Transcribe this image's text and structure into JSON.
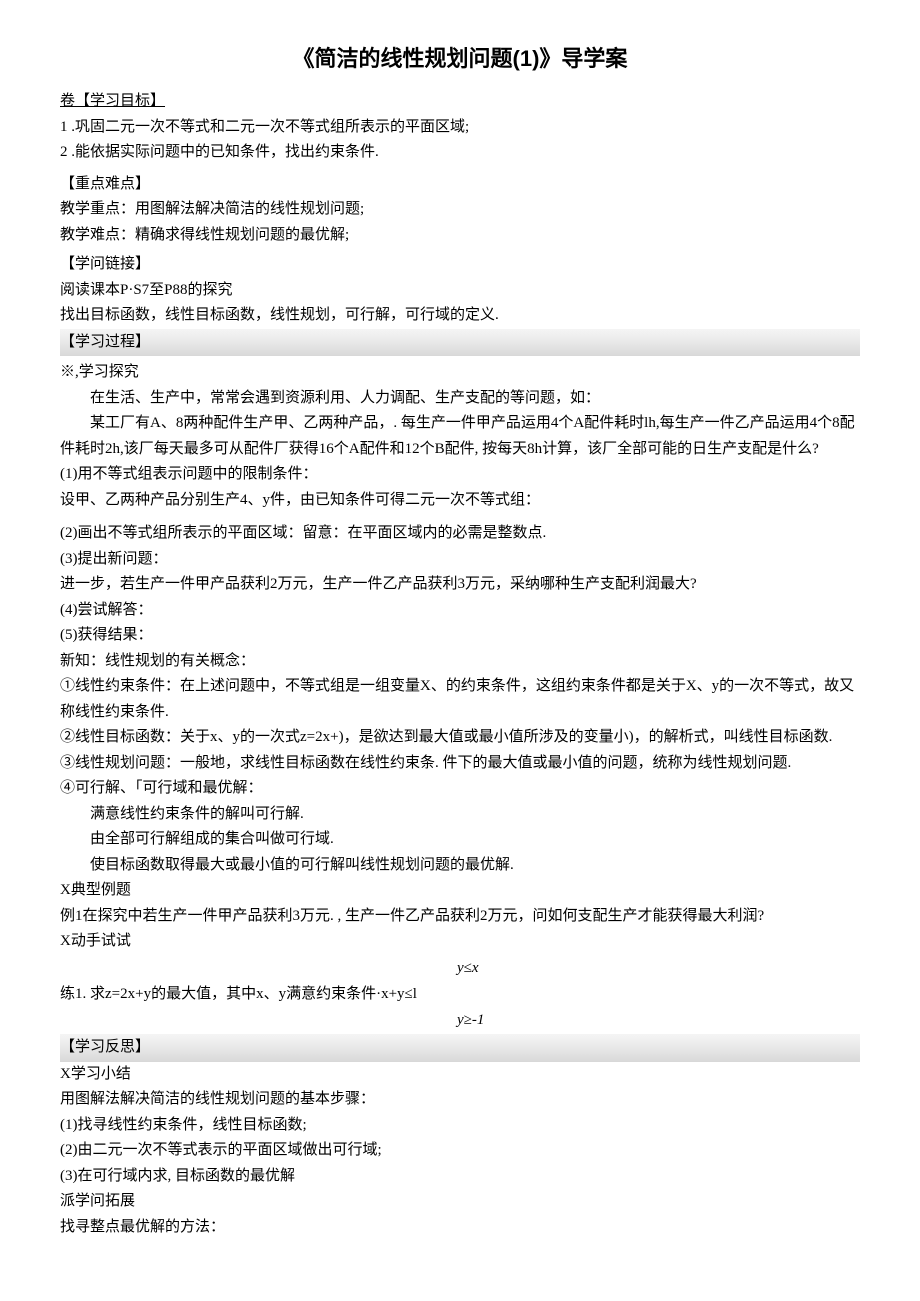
{
  "title": "《简洁的线性规划问题(1)》导学案",
  "s1": {
    "header": "卷【学习目标】",
    "items": [
      "1 .巩固二元一次不等式和二元一次不等式组所表示的平面区域;",
      "2 .能依据实际问题中的已知条件，找出约束条件."
    ]
  },
  "s2": {
    "header": "【重点难点】",
    "lines": [
      "教学重点：用图解法解决简洁的线性规划问题;",
      "教学难点：精确求得线性规划问题的最优解;"
    ]
  },
  "s3": {
    "header": "【学问链接】",
    "lines": [
      "阅读课本P·S7至P88的探究",
      "找出目标函数，线性目标函数，线性规划，可行解，可行域的定义."
    ]
  },
  "s4": {
    "header": "【学习过程】",
    "subheader": "※,学习探究",
    "p1": "在生活、生产中，常常会遇到资源利用、人力调配、生产支配的等问题，如：",
    "p2": "某工厂有A、8两种配件生产甲、乙两种产品，. 每生产一件甲产品运用4个A配件耗时lh,每生产一件乙产品运用4个8配件耗时2h,该厂每天最多可从配件厂获得16个A配件和12个B配件, 按每天8h计算，该厂全部可能的日生产支配是什么?",
    "p3": "(1)用不等式组表示问题中的限制条件：",
    "p4": "设甲、乙两种产品分别生产4、y件，由已知条件可得二元一次不等式组：",
    "p5": "(2)画出不等式组所表示的平面区域：留意：在平面区域内的必需是整数点.",
    "p6": "(3)提出新问题：",
    "p7": "进一步，若生产一件甲产品获利2万元，生产一件乙产品获利3万元，采纳哪种生产支配利润最大?",
    "p8": "(4)尝试解答：",
    "p9": "(5)获得结果：",
    "p10": "新知：线性规划的有关概念：",
    "p11": "①线性约束条件：在上述问题中，不等式组是一组变量X、的约束条件，这组约束条件都是关于X、y的一次不等式，故又称线性约束条件.",
    "p12": "②线性目标函数：关于x、y的一次式z=2x+)，是欲达到最大值或最小值所涉及的变量小)，的解析式，叫线性目标函数.",
    "p13": "③线性规划问题：一般地，求线性目标函数在线性约束条. 件下的最大值或最小值的问题，统称为线性规划问题.",
    "p14": "④可行解、「可行域和最优解：",
    "p15": "满意线性约束条件的解叫可行解.",
    "p16": "由全部可行解组成的集合叫做可行域.",
    "p17": "使目标函数取得最大或最小值的可行解叫线性规划问题的最优解.",
    "p18": "X典型例题",
    "p19": "例1在探究中若生产一件甲产品获利3万元. , 生产一件乙产品获利2万元，问如何支配生产才能获得最大利润?",
    "p20": "X动手试试",
    "p21": "练1. 求z=2x+y的最大值，其中x、y满意约束条件·x+y≤l",
    "c1": "y≤x",
    "c2": "y≥-1"
  },
  "s5": {
    "header": "【学习反思】",
    "lines": [
      "X学习小结",
      "用图解法解决简洁的线性规划问题的基本步骤：",
      "(1)找寻线性约束条件，线性目标函数;",
      "(2)由二元一次不等式表示的平面区域做出可行域;",
      "(3)在可行域内求, 目标函数的最优解",
      "派学问拓展",
      "找寻整点最优解的方法："
    ]
  }
}
